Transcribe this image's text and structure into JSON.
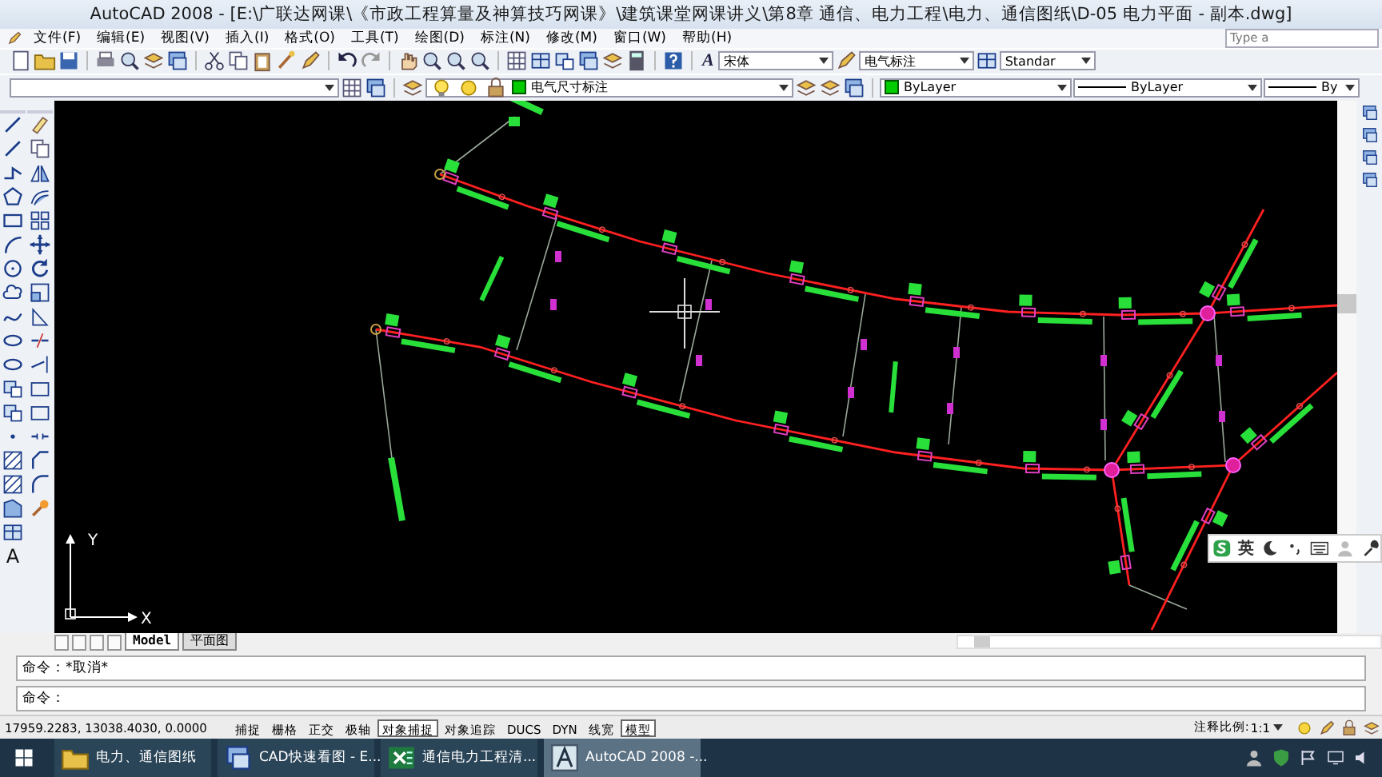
{
  "window": {
    "title": "AutoCAD 2008 - [E:\\广联达网课\\《市政工程算量及神算技巧网课》\\建筑课堂网课讲义\\第8章 通信、电力工程\\电力、通信图纸\\D-05 电力平面 - 副本.dwg]"
  },
  "menu": [
    {
      "label": "文件(F)"
    },
    {
      "label": "编辑(E)"
    },
    {
      "label": "视图(V)"
    },
    {
      "label": "插入(I)"
    },
    {
      "label": "格式(O)"
    },
    {
      "label": "工具(T)"
    },
    {
      "label": "绘图(D)"
    },
    {
      "label": "标注(N)"
    },
    {
      "label": "修改(M)"
    },
    {
      "label": "窗口(W)"
    },
    {
      "label": "帮助(H)"
    }
  ],
  "help_search": {
    "placeholder": "Type a"
  },
  "styles_toolbar": {
    "text_style_glyph": "A",
    "text_style": "宋体",
    "dim_style": "电气标注",
    "table_style": "Standar"
  },
  "layers_toolbar": {
    "layer": "电气尺寸标注",
    "color_setting": "ByLayer",
    "linetype": "ByLayer",
    "lineweight": "By"
  },
  "draw_toolbar": {
    "text_glyph": "A"
  },
  "ucs": {
    "y_label": "Y",
    "x_label": "X"
  },
  "layout_tabs": [
    {
      "label": "Model",
      "selected": true
    },
    {
      "label": "平面图",
      "selected": false
    }
  ],
  "command_lines": [
    "命令：*取消*",
    "命令："
  ],
  "status_bar": {
    "coordinates": "17959.2283, 13038.4030, 0.0000",
    "toggles": [
      {
        "label": "捕捉",
        "on": false
      },
      {
        "label": "栅格",
        "on": false
      },
      {
        "label": "正交",
        "on": false
      },
      {
        "label": "极轴",
        "on": false
      },
      {
        "label": "对象捕捉",
        "on": true
      },
      {
        "label": "对象追踪",
        "on": false
      },
      {
        "label": "DUCS",
        "on": false
      },
      {
        "label": "DYN",
        "on": false
      },
      {
        "label": "线宽",
        "on": false
      },
      {
        "label": "模型",
        "on": true
      }
    ],
    "annotation_scale_label": "注释比例:",
    "annotation_scale": "1:1"
  },
  "ime_bar": {
    "language": "英"
  },
  "taskbar": [
    {
      "label": "电力、通信图纸",
      "kind": "folder",
      "selected": false
    },
    {
      "label": "CAD快速看图 - E...",
      "kind": "viewer",
      "selected": false
    },
    {
      "label": "通信电力工程清...",
      "kind": "spreadsheet",
      "selected": false
    },
    {
      "label": "AutoCAD 2008 -...",
      "kind": "cad",
      "selected": true
    }
  ]
}
